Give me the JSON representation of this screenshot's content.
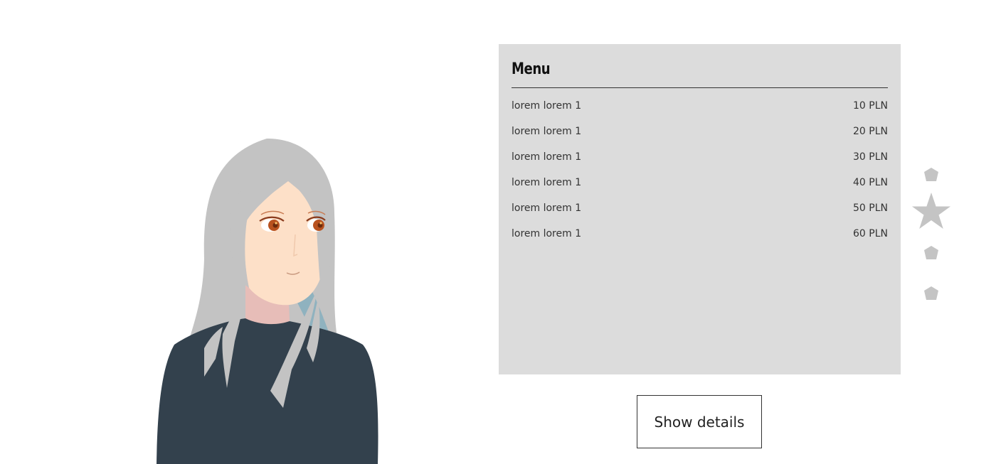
{
  "menu": {
    "title": "Menu",
    "items": [
      {
        "name": "lorem lorem 1",
        "price": "10 PLN"
      },
      {
        "name": "lorem lorem 1",
        "price": "20 PLN"
      },
      {
        "name": "lorem lorem 1",
        "price": "30 PLN"
      },
      {
        "name": "lorem lorem 1",
        "price": "40 PLN"
      },
      {
        "name": "lorem lorem 1",
        "price": "50 PLN"
      },
      {
        "name": "lorem lorem 1",
        "price": "60 PLN"
      }
    ]
  },
  "details_button": {
    "label": "Show details"
  },
  "slider": {
    "count": 4,
    "active_index": 1
  },
  "colors": {
    "panel_bg": "#dcdcdc",
    "nav_inactive": "#c4c4c4",
    "hair": "#c3c3c3",
    "skin": "#fde0c8",
    "sweater": "#33414d"
  }
}
